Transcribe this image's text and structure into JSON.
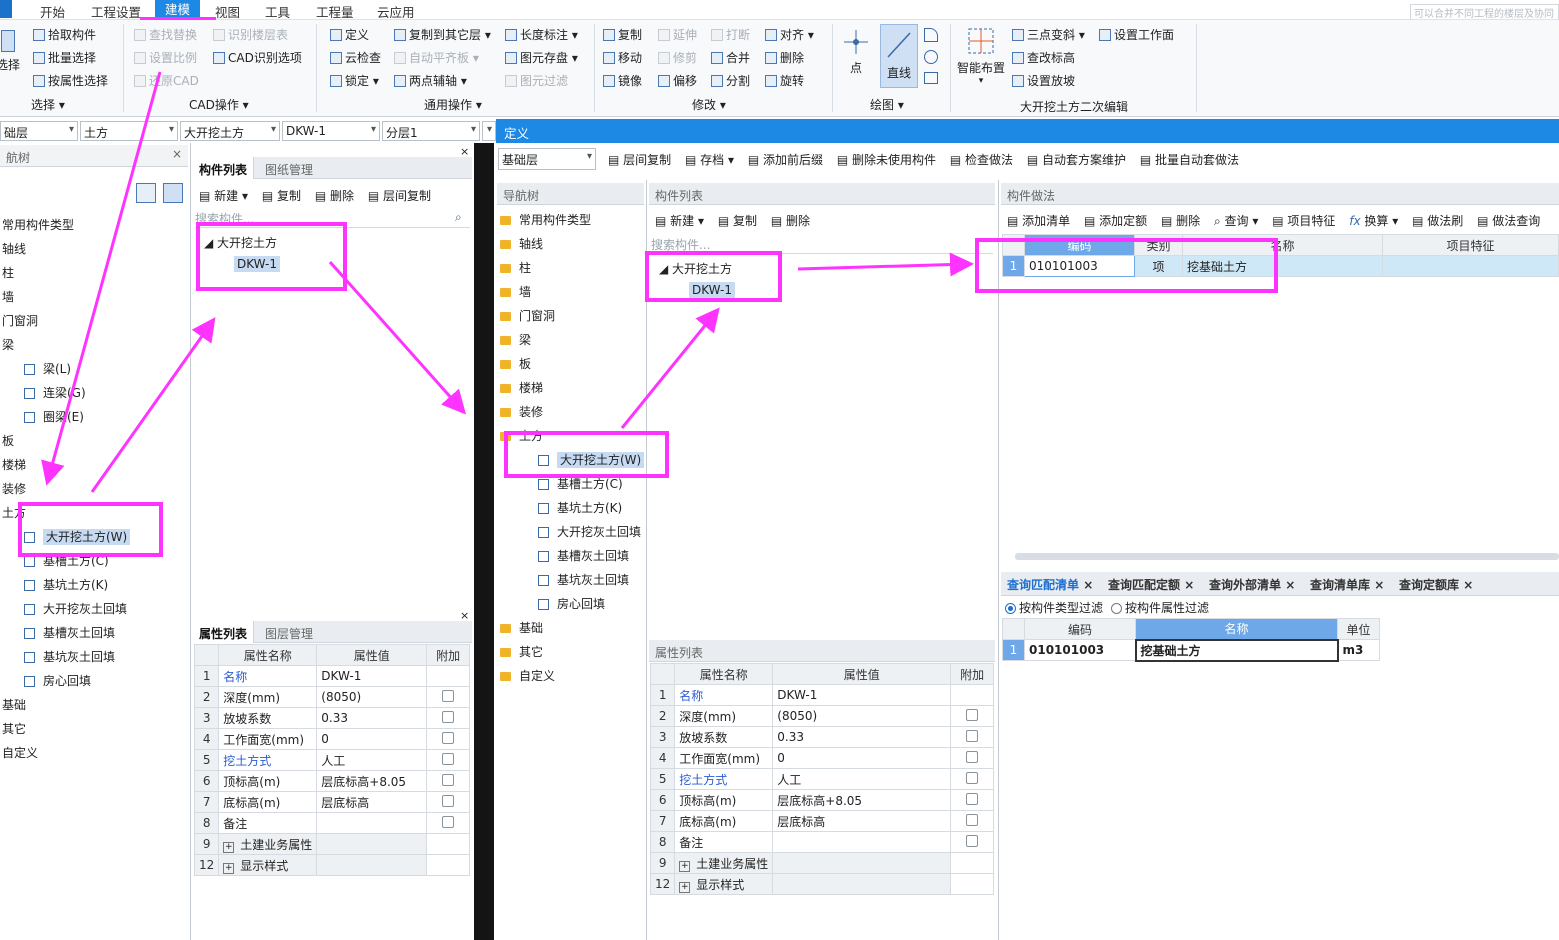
{
  "menu": {
    "items": [
      "开始",
      "工程设置",
      "建模",
      "视图",
      "工具",
      "工程量",
      "云应用"
    ]
  },
  "ribbon": {
    "select": {
      "big": "选择",
      "items": [
        "拾取构件",
        "批量选择",
        "按属性选择"
      ],
      "group": "选择"
    },
    "cad": {
      "items": [
        "查找替换",
        "设置比例",
        "还原CAD",
        "识别楼层表",
        "CAD识别选项"
      ],
      "group": "CAD操作"
    },
    "general": {
      "items": [
        "定义",
        "云检查",
        "锁定",
        "复制到其它层",
        "自动平齐板",
        "两点辅轴",
        "长度标注",
        "图元存盘",
        "图元过滤"
      ],
      "group": "通用操作"
    },
    "modify": {
      "items": [
        "复制",
        "移动",
        "镜像",
        "延伸",
        "修剪",
        "偏移",
        "打断",
        "合并",
        "分割",
        "对齐",
        "删除",
        "旋转"
      ],
      "group": "修改"
    },
    "draw": {
      "items": [
        "点",
        "直线"
      ],
      "group": "绘图"
    },
    "edit2": {
      "items": [
        "智能布置",
        "三点变斜",
        "查改标高",
        "设置放坡",
        "设置工作面"
      ],
      "group": "大开挖土方二次编辑"
    }
  },
  "combos": [
    "础层",
    "土方",
    "大开挖土方",
    "DKW-1",
    "分层1"
  ],
  "top_right_text": "可以合并不同工程的楼层及协同",
  "left_nav": {
    "title": "航树",
    "items": [
      "常用构件类型",
      "轴线",
      "柱",
      "墙",
      "门窗洞",
      "梁",
      "梁(L)",
      "连梁(G)",
      "圈梁(E)",
      "板",
      "楼梯",
      "装修",
      "土方",
      "大开挖土方(W)",
      "基槽土方(C)",
      "基坑土方(K)",
      "大开挖灰土回填",
      "基槽灰土回填",
      "基坑灰土回填",
      "房心回填",
      "基础",
      "其它",
      "自定义"
    ]
  },
  "comp_list_1": {
    "tabs": [
      "构件列表",
      "图纸管理"
    ],
    "toolbar": [
      "新建",
      "复制",
      "删除",
      "层间复制"
    ],
    "search_placeholder": "搜索构件...",
    "tree_parent": "大开挖土方",
    "tree_child": "DKW-1"
  },
  "prop_tabs": [
    "属性列表",
    "图层管理"
  ],
  "prop_header": [
    "属性名称",
    "属性值",
    "附加"
  ],
  "props": [
    {
      "n": "1",
      "name": "名称",
      "value": "DKW-1",
      "link": true,
      "cb": false
    },
    {
      "n": "2",
      "name": "深度(mm)",
      "value": "(8050)",
      "link": false,
      "cb": true
    },
    {
      "n": "3",
      "name": "放坡系数",
      "value": "0.33",
      "link": false,
      "cb": true
    },
    {
      "n": "4",
      "name": "工作面宽(mm)",
      "value": "0",
      "link": false,
      "cb": true
    },
    {
      "n": "5",
      "name": "挖土方式",
      "value": "人工",
      "link": true,
      "cb": true
    },
    {
      "n": "6",
      "name": "顶标高(m)",
      "value": "层底标高+8.05",
      "link": false,
      "cb": true
    },
    {
      "n": "7",
      "name": "底标高(m)",
      "value": "层底标高",
      "link": false,
      "cb": true
    },
    {
      "n": "8",
      "name": "备注",
      "value": "",
      "link": false,
      "cb": true
    },
    {
      "n": "9",
      "name": "土建业务属性",
      "value": "",
      "link": false,
      "cb": false,
      "group": true
    },
    {
      "n": "12",
      "name": "显示样式",
      "value": "",
      "link": false,
      "cb": false,
      "group": true
    }
  ],
  "definition": {
    "title": "定义",
    "floor": "基础层",
    "toolbar": [
      "层间复制",
      "存档",
      "添加前后缀",
      "删除未使用构件",
      "检查做法",
      "自动套方案维护",
      "批量自动套做法"
    ],
    "nav_title": "导航树",
    "nav_items": [
      "常用构件类型",
      "轴线",
      "柱",
      "墙",
      "门窗洞",
      "梁",
      "板",
      "楼梯",
      "装修",
      "土方",
      "大开挖土方(W)",
      "基槽土方(C)",
      "基坑土方(K)",
      "大开挖灰土回填",
      "基槽灰土回填",
      "基坑灰土回填",
      "房心回填",
      "基础",
      "其它",
      "自定义"
    ],
    "comp_title": "构件列表",
    "comp_toolbar": [
      "新建",
      "复制",
      "删除"
    ],
    "search_placeholder": "搜索构件...",
    "tree_parent": "大开挖土方",
    "tree_child": "DKW-1",
    "prop_title": "属性列表",
    "method_title": "构件做法",
    "method_toolbar": [
      "添加清单",
      "添加定额",
      "删除",
      "查询",
      "项目特征",
      "换算",
      "做法刷",
      "做法查询"
    ],
    "method_header": [
      "编码",
      "类别",
      "名称",
      "项目特征"
    ],
    "method_row": {
      "n": "1",
      "code": "010101003",
      "type": "项",
      "name": "挖基础土方"
    },
    "bottom_tabs": [
      "查询匹配清单",
      "查询匹配定额",
      "查询外部清单",
      "查询清单库",
      "查询定额库"
    ],
    "filters": [
      "按构件类型过滤",
      "按构件属性过滤"
    ],
    "match_header": [
      "编码",
      "名称",
      "单位"
    ],
    "match_row": {
      "n": "1",
      "code": "010101003",
      "name": "挖基础土方",
      "unit": "m3"
    }
  },
  "colors": {
    "accent": "#1e88e5",
    "annotation": "#ff33ff"
  }
}
